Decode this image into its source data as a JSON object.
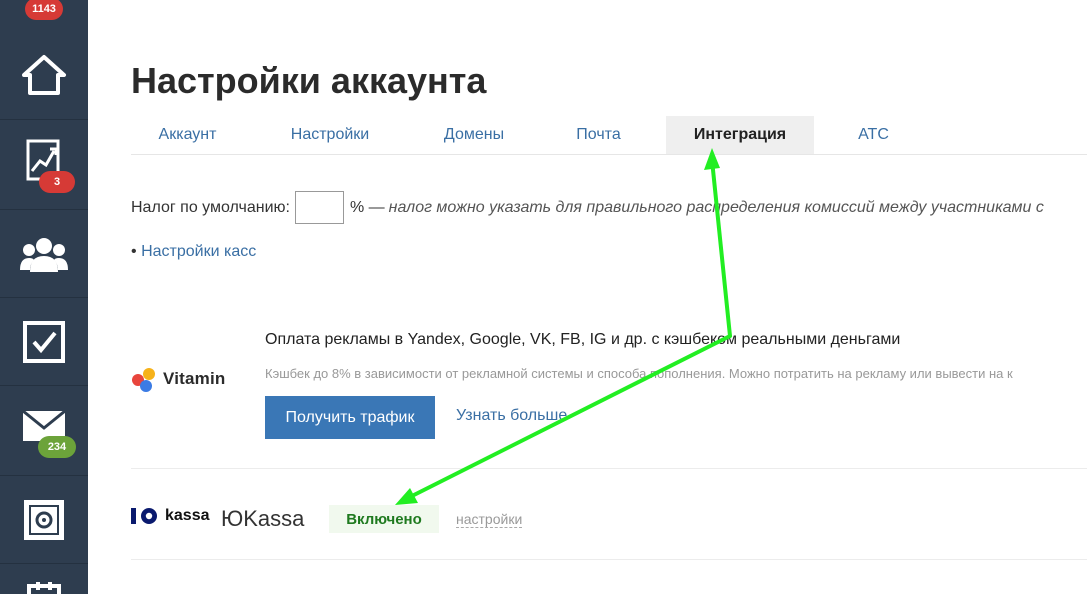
{
  "sidebar": {
    "badges": {
      "top": "1143",
      "analytics": "3",
      "mail": "234"
    },
    "items": [
      {
        "icon": "home-icon"
      },
      {
        "icon": "chart-icon"
      },
      {
        "icon": "users-icon"
      },
      {
        "icon": "checkbox-icon"
      },
      {
        "icon": "mail-icon"
      },
      {
        "icon": "safe-icon"
      },
      {
        "icon": "calendar-icon"
      }
    ]
  },
  "page": {
    "title": "Настройки аккаунта"
  },
  "tabs": [
    {
      "label": "Аккаунт"
    },
    {
      "label": "Настройки"
    },
    {
      "label": "Домены"
    },
    {
      "label": "Почта"
    },
    {
      "label": "Интеграция",
      "active": true
    },
    {
      "label": "АТС"
    }
  ],
  "tax": {
    "label": "Налог по умолчанию:",
    "value": "",
    "suffix": "% —",
    "note": "налог можно указать для правильного распределения комиссий между участниками с"
  },
  "cashboxes": {
    "bullet": "•",
    "link": "Настройки касс"
  },
  "vitamin": {
    "logo_text": "Vitamin",
    "title": "Оплата рекламы в Yandex, Google, VK, FB, IG и др. с кэшбеком реальными деньгами",
    "description": "Кэшбек до 8% в зависимости от рекламной системы и способа пополнения. Можно потратить на рекламу или вывести на к",
    "button": "Получить трафик",
    "learn_more": "Узнать больше"
  },
  "yookassa": {
    "logo_text": "kassa",
    "name": "ЮKassa",
    "status": "Включено",
    "settings": "настройки"
  },
  "colors": {
    "sidebar": "#2e3d4f",
    "link": "#3a6fa4",
    "primary_button": "#3a77b6",
    "badge_red": "#d63a36",
    "badge_green": "#6ca33a",
    "enabled_text": "#1f7a1f",
    "annotation_arrow": "#22ee22"
  }
}
